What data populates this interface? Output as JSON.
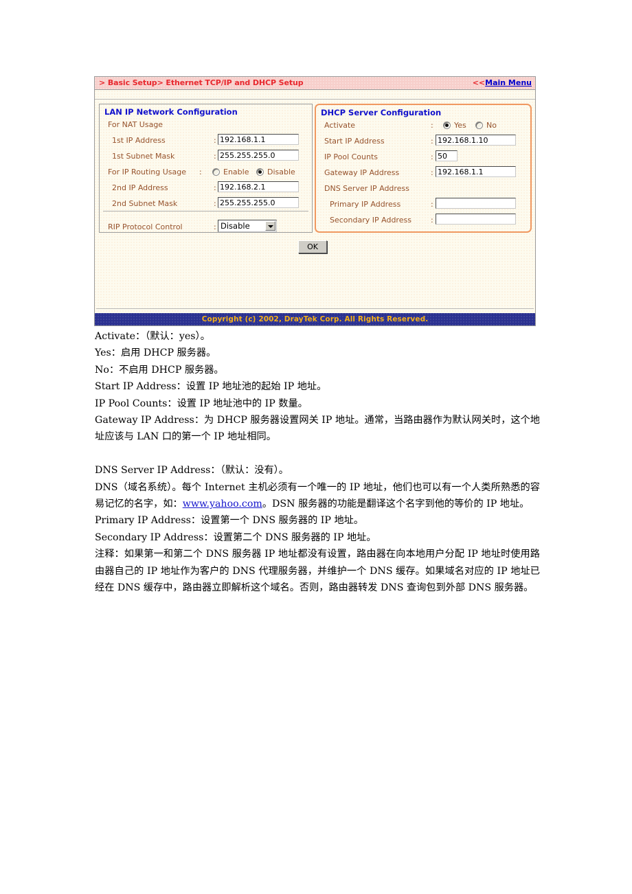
{
  "router_ui": {
    "title_breadcrumb": "> Basic Setup> Ethernet TCP/IP and DHCP Setup",
    "main_menu_arrows": "<<",
    "main_menu_link": "Main Menu",
    "lan_panel": {
      "title": "LAN IP Network Configuration",
      "nat_usage_label": "For NAT Usage",
      "first_ip_label": "1st IP Address",
      "first_ip_value": "192.168.1.1",
      "first_mask_label": "1st Subnet Mask",
      "first_mask_value": "255.255.255.0",
      "routing_usage_label": "For IP Routing Usage",
      "routing_enable_label": "Enable",
      "routing_disable_label": "Disable",
      "routing_selected": "Disable",
      "second_ip_label": "2nd IP Address",
      "second_ip_value": "192.168.2.1",
      "second_mask_label": "2nd Subnet Mask",
      "second_mask_value": "255.255.255.0",
      "rip_label": "RIP Protocol Control",
      "rip_value": "Disable",
      "colon": ":"
    },
    "dhcp_panel": {
      "title": "DHCP Server Configuration",
      "activate_label": "Activate",
      "activate_yes_label": "Yes",
      "activate_no_label": "No",
      "activate_selected": "Yes",
      "start_ip_label": "Start IP Address",
      "start_ip_value": "192.168.1.10",
      "pool_counts_label": "IP Pool Counts",
      "pool_counts_value": "50",
      "gateway_label": "Gateway IP Address",
      "gateway_value": "192.168.1.1",
      "dns_section_label": "DNS Server IP Address",
      "primary_label": "Primary IP Address",
      "primary_value": "",
      "secondary_label": "Secondary IP Address",
      "secondary_value": "",
      "colon": ":"
    },
    "ok_button_label": "OK",
    "copyright": "Copyright (c) 2002, DrayTek Corp. All Rights Reserved."
  },
  "doc": {
    "p1": "Activate：（默认：yes）。",
    "p2": "Yes：启用 DHCP 服务器。",
    "p3": "No：不启用 DHCP 服务器。",
    "p4": "Start IP Address：设置 IP 地址池的起始 IP 地址。",
    "p5": "IP Pool Counts：设置 IP 地址池中的 IP 数量。",
    "p6": "Gateway IP Address：为 DHCP 服务器设置网关 IP 地址。通常，当路由器作为默认网关时，这个地址应该与 LAN 口的第一个 IP 地址相同。",
    "p7": "DNS Server IP Address：（默认：没有）。",
    "p8_before_link": "DNS（域名系统）。每个 Internet 主机必须有一个唯一的 IP 地址，他们也可以有一个人类所熟悉的容易记忆的名字，如：",
    "p8_link": "www.yahoo.com",
    "p8_after_link": "。DSN 服务器的功能是翻译这个名字到他的等价的 IP 地址。",
    "p9": "Primary IP Address：设置第一个 DNS 服务器的 IP 地址。",
    "p10": "Secondary IP Address：设置第二个 DNS 服务器的 IP 地址。",
    "p11": "注释：如果第一和第二个 DNS 服务器 IP 地址都没有设置，路由器在向本地用户分配 IP 地址时使用路由器自己的 IP 地址作为客户的 DNS 代理服务器，并维护一个 DNS 缓存。如果域名对应的 IP 地址已经在 DNS 缓存中，路由器立即解析这个域名。否则，路由器转发 DNS 查询包到外部 DNS 服务器。"
  }
}
